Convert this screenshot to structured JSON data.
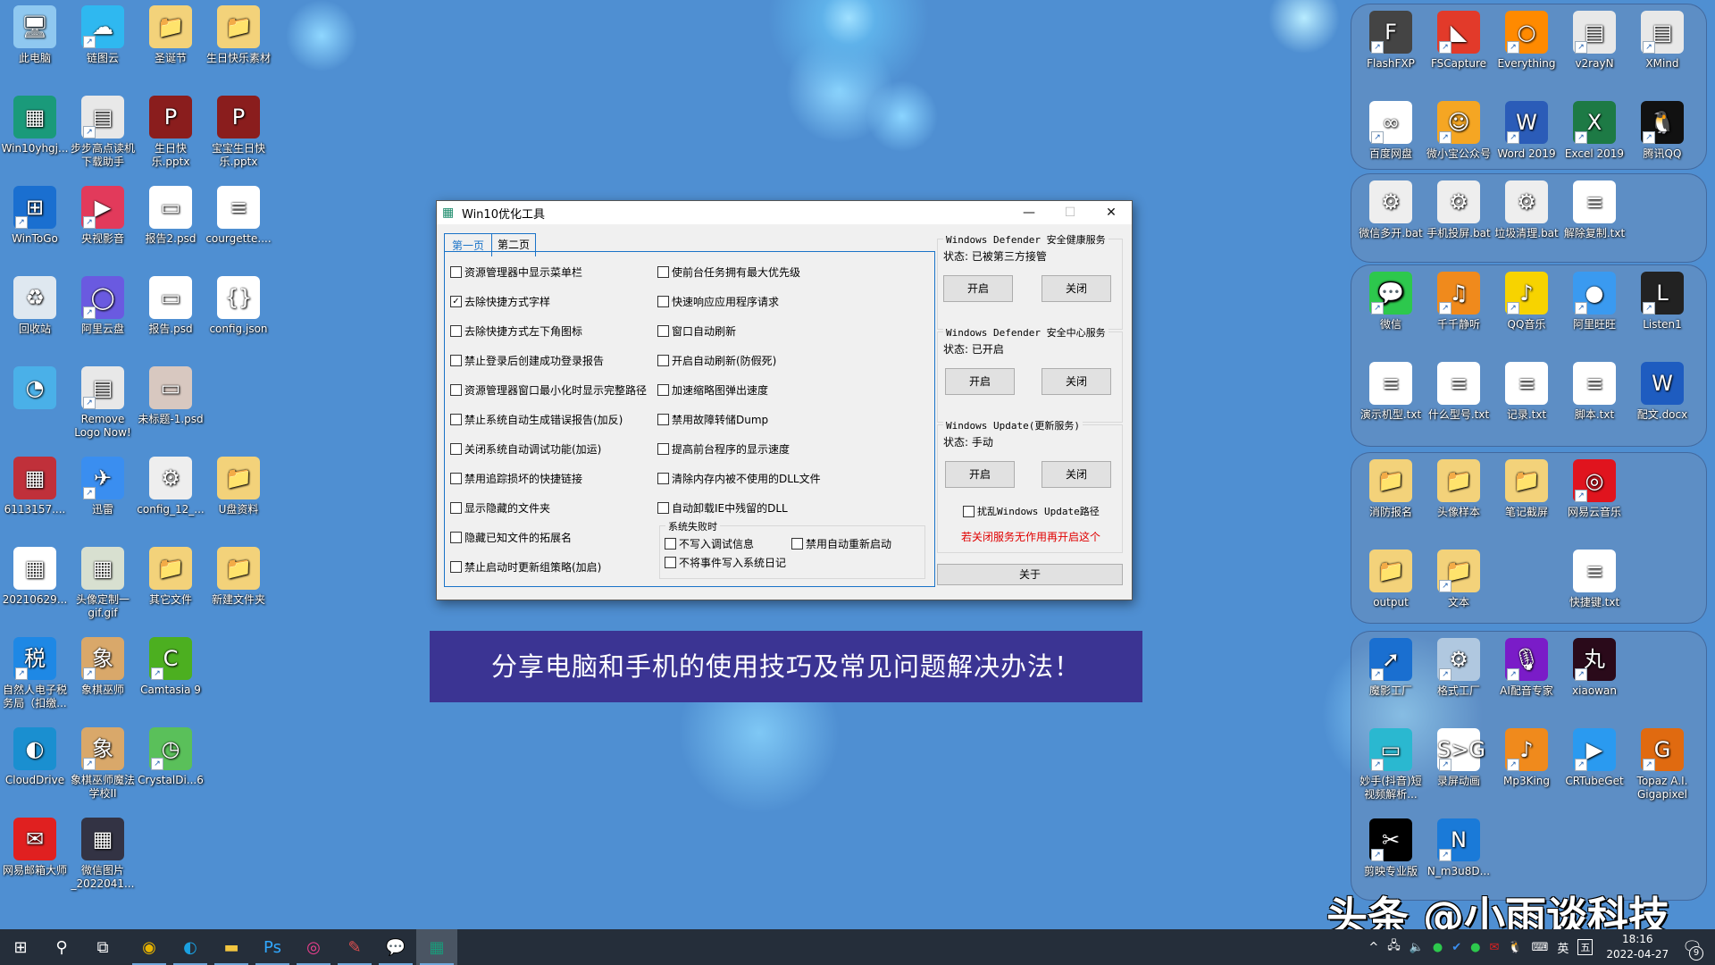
{
  "desktop_left": [
    {
      "label": "此电脑",
      "icon": "computer-icon",
      "glyph": "🖥",
      "color": "#8fc8f0",
      "shortcut": false
    },
    {
      "label": "链图云",
      "icon": "cloud-link-icon",
      "glyph": "☁",
      "color": "#2fb8f0",
      "shortcut": true
    },
    {
      "label": "圣诞节",
      "icon": "folder-icon",
      "glyph": "📁",
      "color": "#f3d27a",
      "shortcut": false
    },
    {
      "label": "生日快乐素材",
      "icon": "folder-icon",
      "glyph": "📁",
      "color": "#f3d27a",
      "shortcut": false
    },
    {
      "label": "Win10yhgj...",
      "icon": "win10-tool-icon",
      "glyph": "▦",
      "color": "#1a9a7a",
      "shortcut": false
    },
    {
      "label": "步步高点读机下载助手",
      "icon": "app-window-icon",
      "glyph": "▤",
      "color": "#e8e8e8",
      "shortcut": true
    },
    {
      "label": "生日快乐.pptx",
      "icon": "pptx-icon",
      "glyph": "P",
      "color": "#8a1d1d",
      "shortcut": false
    },
    {
      "label": "宝宝生日快乐.pptx",
      "icon": "pptx-icon",
      "glyph": "P",
      "color": "#8a1d1d",
      "shortcut": false
    },
    {
      "label": "WinToGo",
      "icon": "wintogo-icon",
      "glyph": "⊞",
      "color": "#1a6fd0",
      "shortcut": true
    },
    {
      "label": "央视影音",
      "icon": "cctv-player-icon",
      "glyph": "▶",
      "color": "#e23a5b",
      "shortcut": true
    },
    {
      "label": "报告2.psd",
      "icon": "psd-file-icon",
      "glyph": "▭",
      "color": "#ffffff",
      "shortcut": false
    },
    {
      "label": "courgette....",
      "icon": "text-file-icon",
      "glyph": "≡",
      "color": "#ffffff",
      "shortcut": false
    },
    {
      "label": "回收站",
      "icon": "recycle-bin-icon",
      "glyph": "♻",
      "color": "#dfe8f0",
      "shortcut": false
    },
    {
      "label": "阿里云盘",
      "icon": "aliyun-drive-icon",
      "glyph": "◯",
      "color": "#6a5ae0",
      "shortcut": true
    },
    {
      "label": "报告.psd",
      "icon": "psd-file-icon",
      "glyph": "▭",
      "color": "#ffffff",
      "shortcut": false
    },
    {
      "label": "config.json",
      "icon": "json-file-icon",
      "glyph": "{}",
      "color": "#ffffff",
      "shortcut": false
    },
    {
      "label": "",
      "icon": "control-panel-icon",
      "glyph": "◔",
      "color": "#4ab0e8",
      "shortcut": false
    },
    {
      "label": "Remove Logo Now!",
      "icon": "app-window-icon",
      "glyph": "▤",
      "color": "#e8e8e8",
      "shortcut": true
    },
    {
      "label": "未标题-1.psd",
      "icon": "psd-file-icon",
      "glyph": "▭",
      "color": "#d8c8c0",
      "shortcut": false
    },
    {
      "label": "",
      "icon": "",
      "glyph": "",
      "color": "",
      "shortcut": false
    },
    {
      "label": "6113157....",
      "icon": "image-file-icon",
      "glyph": "▦",
      "color": "#c0303a",
      "shortcut": false
    },
    {
      "label": "迅雷",
      "icon": "xunlei-icon",
      "glyph": "✈",
      "color": "#3a8ef0",
      "shortcut": true
    },
    {
      "label": "config_12_...",
      "icon": "config-file-icon",
      "glyph": "⚙",
      "color": "#eeeeee",
      "shortcut": false
    },
    {
      "label": "U盘资料",
      "icon": "folder-icon",
      "glyph": "📁",
      "color": "#f3d27a",
      "shortcut": false
    },
    {
      "label": "20210629...",
      "icon": "image-file-icon",
      "glyph": "▦",
      "color": "#ffffff",
      "shortcut": false
    },
    {
      "label": "头像定制一gif.gif",
      "icon": "gif-file-icon",
      "glyph": "▦",
      "color": "#d8e0d0",
      "shortcut": false
    },
    {
      "label": "其它文件",
      "icon": "folder-icon",
      "glyph": "📁",
      "color": "#f3d27a",
      "shortcut": false
    },
    {
      "label": "新建文件夹",
      "icon": "folder-icon",
      "glyph": "📁",
      "color": "#f3d27a",
      "shortcut": false
    },
    {
      "label": "自然人电子税务局（扣缴...",
      "icon": "tax-app-icon",
      "glyph": "税",
      "color": "#1e88e5",
      "shortcut": true
    },
    {
      "label": "象棋巫师",
      "icon": "chess-icon",
      "glyph": "象",
      "color": "#d9a86a",
      "shortcut": true
    },
    {
      "label": "Camtasia 9",
      "icon": "camtasia-icon",
      "glyph": "C",
      "color": "#4caf20",
      "shortcut": true
    },
    {
      "label": "",
      "icon": "",
      "glyph": "",
      "color": "",
      "shortcut": false
    },
    {
      "label": "CloudDrive",
      "icon": "edge-like-icon",
      "glyph": "◐",
      "color": "#1a8fd0",
      "shortcut": false
    },
    {
      "label": "象棋巫师魔法学校II",
      "icon": "chess-icon",
      "glyph": "象",
      "color": "#d9a86a",
      "shortcut": true
    },
    {
      "label": "CrystalDi...6",
      "icon": "crystaldisk-icon",
      "glyph": "◷",
      "color": "#5ac05a",
      "shortcut": true
    },
    {
      "label": "",
      "icon": "",
      "glyph": "",
      "color": "",
      "shortcut": false
    },
    {
      "label": "网易邮箱大师",
      "icon": "netease-mail-icon",
      "glyph": "✉",
      "color": "#e02020",
      "shortcut": false
    },
    {
      "label": "微信图片_2022041...",
      "icon": "image-file-icon",
      "glyph": "▦",
      "color": "#334",
      "shortcut": false
    }
  ],
  "groups": [
    {
      "items": [
        {
          "label": "FlashFXP",
          "icon": "flashfxp-icon",
          "glyph": "F",
          "color": "#444",
          "shortcut": true
        },
        {
          "label": "FSCapture",
          "icon": "fscapture-icon",
          "glyph": "◣",
          "color": "#e23a2a",
          "shortcut": true
        },
        {
          "label": "Everything",
          "icon": "everything-icon",
          "glyph": "○",
          "color": "#ff8a00",
          "shortcut": true
        },
        {
          "label": "v2rayN",
          "icon": "app-window-icon",
          "glyph": "▤",
          "color": "#e8e8e8",
          "shortcut": true
        },
        {
          "label": "XMind",
          "icon": "app-window-icon",
          "glyph": "▤",
          "color": "#e8e8e8",
          "shortcut": true
        },
        {
          "label": "百度网盘",
          "icon": "baidu-netdisk-icon",
          "glyph": "∞",
          "color": "#ffffff",
          "shortcut": true
        },
        {
          "label": "微小宝公众号",
          "icon": "weixiaobao-icon",
          "glyph": "☺",
          "color": "#f5a623",
          "shortcut": true
        },
        {
          "label": "Word 2019",
          "icon": "word-icon",
          "glyph": "W",
          "color": "#2b5cb8",
          "shortcut": true
        },
        {
          "label": "Excel 2019",
          "icon": "excel-icon",
          "glyph": "X",
          "color": "#1d7a45",
          "shortcut": true
        },
        {
          "label": "腾讯QQ",
          "icon": "qq-icon",
          "glyph": "🐧",
          "color": "#111",
          "shortcut": true
        }
      ]
    },
    {
      "items": [
        {
          "label": "微信多开.bat",
          "icon": "bat-file-icon",
          "glyph": "⚙",
          "color": "#eeeeee",
          "shortcut": false
        },
        {
          "label": "手机投屏.bat",
          "icon": "bat-file-icon",
          "glyph": "⚙",
          "color": "#eeeeee",
          "shortcut": false
        },
        {
          "label": "垃圾清理.bat",
          "icon": "bat-file-icon",
          "glyph": "⚙",
          "color": "#eeeeee",
          "shortcut": false
        },
        {
          "label": "解除复制.txt",
          "icon": "text-file-icon",
          "glyph": "≡",
          "color": "#ffffff",
          "shortcut": false
        }
      ]
    },
    {
      "items": [
        {
          "label": "微信",
          "icon": "wechat-icon",
          "glyph": "💬",
          "color": "#2dc84d",
          "shortcut": true
        },
        {
          "label": "千千静听",
          "icon": "ttplayer-icon",
          "glyph": "♫",
          "color": "#f08a1c",
          "shortcut": true
        },
        {
          "label": "QQ音乐",
          "icon": "qq-music-icon",
          "glyph": "♪",
          "color": "#f7d300",
          "shortcut": true
        },
        {
          "label": "阿里旺旺",
          "icon": "aliwangwang-icon",
          "glyph": "●",
          "color": "#3a9af0",
          "shortcut": true
        },
        {
          "label": "Listen1",
          "icon": "listen1-icon",
          "glyph": "L",
          "color": "#222",
          "shortcut": true
        },
        {
          "label": "演示机型.txt",
          "icon": "text-file-icon",
          "glyph": "≡",
          "color": "#ffffff",
          "shortcut": false
        },
        {
          "label": "什么型号.txt",
          "icon": "text-file-icon",
          "glyph": "≡",
          "color": "#ffffff",
          "shortcut": false
        },
        {
          "label": "记录.txt",
          "icon": "text-file-icon",
          "glyph": "≡",
          "color": "#ffffff",
          "shortcut": false
        },
        {
          "label": "脚本.txt",
          "icon": "text-file-icon",
          "glyph": "≡",
          "color": "#ffffff",
          "shortcut": false
        },
        {
          "label": "配文.docx",
          "icon": "docx-file-icon",
          "glyph": "W",
          "color": "#1e5cc0",
          "shortcut": false
        }
      ]
    },
    {
      "items": [
        {
          "label": "消防报名",
          "icon": "folder-icon",
          "glyph": "📁",
          "color": "#f3d27a",
          "shortcut": false
        },
        {
          "label": "头像样本",
          "icon": "folder-icon",
          "glyph": "📁",
          "color": "#f3d27a",
          "shortcut": false
        },
        {
          "label": "笔记截屏",
          "icon": "folder-icon",
          "glyph": "📁",
          "color": "#f3d27a",
          "shortcut": false
        },
        {
          "label": "网易云音乐",
          "icon": "netease-music-icon",
          "glyph": "◎",
          "color": "#e0141e",
          "shortcut": true
        },
        {
          "label": "",
          "icon": "",
          "glyph": "",
          "color": "",
          "shortcut": false
        },
        {
          "label": "output",
          "icon": "folder-icon",
          "glyph": "📁",
          "color": "#f3d27a",
          "shortcut": false
        },
        {
          "label": "文本",
          "icon": "folder-icon",
          "glyph": "📁",
          "color": "#f3d27a",
          "shortcut": true
        },
        {
          "label": "",
          "icon": "",
          "glyph": "",
          "color": "",
          "shortcut": false
        },
        {
          "label": "快捷键.txt",
          "icon": "text-file-icon",
          "glyph": "≡",
          "color": "#ffffff",
          "shortcut": false
        }
      ]
    },
    {
      "items": [
        {
          "label": "魔影工厂",
          "icon": "moying-icon",
          "glyph": "➚",
          "color": "#1a6fd0",
          "shortcut": true
        },
        {
          "label": "格式工厂",
          "icon": "format-factory-icon",
          "glyph": "⚙",
          "color": "#b0c8e0",
          "shortcut": true
        },
        {
          "label": "AI配音专家",
          "icon": "ai-voice-icon",
          "glyph": "🎙",
          "color": "#7a1cc8",
          "shortcut": true
        },
        {
          "label": "xiaowan",
          "icon": "xiaowan-icon",
          "glyph": "丸",
          "color": "#2a0a1a",
          "shortcut": true
        },
        {
          "label": "",
          "icon": "",
          "glyph": "",
          "color": "",
          "shortcut": false
        },
        {
          "label": "妙手(抖音)短视频解析...",
          "icon": "miaoshou-icon",
          "glyph": "▭",
          "color": "#2ab8d0",
          "shortcut": true
        },
        {
          "label": "录屏动画",
          "icon": "s2g-icon",
          "glyph": "S>G",
          "color": "#ffffff",
          "shortcut": true
        },
        {
          "label": "Mp3King",
          "icon": "mp3king-icon",
          "glyph": "♪",
          "color": "#f08a1c",
          "shortcut": true
        },
        {
          "label": "CRTubeGet",
          "icon": "crtubeget-icon",
          "glyph": "▶",
          "color": "#2a9af0",
          "shortcut": true
        },
        {
          "label": "Topaz A.I. Gigapixel",
          "icon": "topaz-icon",
          "glyph": "G",
          "color": "#e06a10",
          "shortcut": true
        },
        {
          "label": "剪映专业版",
          "icon": "capcut-icon",
          "glyph": "✂",
          "color": "#000000",
          "shortcut": true
        },
        {
          "label": "N_m3u8D...",
          "icon": "nm3u8-icon",
          "glyph": "N",
          "color": "#1a7ad8",
          "shortcut": true
        }
      ]
    }
  ],
  "dialog": {
    "title": "Win10优化工具",
    "minimize": "—",
    "maximize": "☐",
    "close": "✕",
    "tabs": [
      {
        "label": "第一页",
        "active": true
      },
      {
        "label": "第二页",
        "active": false
      }
    ],
    "left_options": [
      {
        "label": "资源管理器中显示菜单栏",
        "checked": false
      },
      {
        "label": "去除快捷方式字样",
        "checked": true
      },
      {
        "label": "去除快捷方式左下角图标",
        "checked": false
      },
      {
        "label": "禁止登录后创建成功登录报告",
        "checked": false
      },
      {
        "label": "资源管理器窗口最小化时显示完整路径",
        "checked": false
      },
      {
        "label": "禁止系统自动生成错误报告(加反)",
        "checked": false
      },
      {
        "label": "关闭系统自动调试功能(加运)",
        "checked": false
      },
      {
        "label": "禁用追踪损坏的快捷链接",
        "checked": false
      },
      {
        "label": "显示隐藏的文件夹",
        "checked": false
      },
      {
        "label": "隐藏已知文件的拓展名",
        "checked": false
      },
      {
        "label": "禁止启动时更新组策略(加启)",
        "checked": false
      }
    ],
    "right_options": [
      {
        "label": "使前台任务拥有最大优先级",
        "checked": false
      },
      {
        "label": "快速响应应用程序请求",
        "checked": false
      },
      {
        "label": "窗口自动刷新",
        "checked": false
      },
      {
        "label": "开启自动刷新(防假死)",
        "checked": false
      },
      {
        "label": "加速缩略图弹出速度",
        "checked": false
      },
      {
        "label": "禁用故障转储Dump",
        "checked": false
      },
      {
        "label": "提高前台程序的显示速度",
        "checked": false
      },
      {
        "label": "清除内存内被不使用的DLL文件",
        "checked": false
      },
      {
        "label": "自动卸载IE中残留的DLL",
        "checked": false
      }
    ],
    "failure_group": {
      "legend": "系统失败时",
      "options": [
        {
          "label": "不写入调试信息",
          "checked": false
        },
        {
          "label": "禁用自动重新启动",
          "checked": false
        },
        {
          "label": "不将事件写入系统日记",
          "checked": false
        }
      ]
    },
    "services": [
      {
        "legend": "Windows Defender 安全健康服务",
        "status": "状态: 已被第三方接管",
        "on": "开启",
        "off": "关闭"
      },
      {
        "legend": "Windows Defender 安全中心服务",
        "status": "状态: 已开启",
        "on": "开启",
        "off": "关闭"
      },
      {
        "legend": "Windows Update(更新服务)",
        "status": "状态: 手动",
        "on": "开启",
        "off": "关闭"
      }
    ],
    "scramble_option": {
      "label": "扰乱Windows Update路径",
      "checked": false
    },
    "warning": "若关闭服务无作用再开启这个",
    "about": "关于",
    "warning_color": "#e00000",
    "accent_color": "#1a73c8"
  },
  "banner": {
    "text": "分享电脑和手机的使用技巧及常见问题解决办法！",
    "bg": "#3b3493"
  },
  "watermark": "头条 @小雨谈科技",
  "taskbar": {
    "items": [
      {
        "name": "start-button",
        "glyph": "⊞"
      },
      {
        "name": "search-button",
        "glyph": "⚲"
      },
      {
        "name": "task-view-button",
        "glyph": "⧉"
      },
      {
        "name": "chrome-taskbar-icon",
        "glyph": "◉",
        "color": "#e8b400"
      },
      {
        "name": "edge-taskbar-icon",
        "glyph": "◐",
        "color": "#1aa0e0"
      },
      {
        "name": "file-explorer-taskbar-icon",
        "glyph": "▬",
        "color": "#f3c640"
      },
      {
        "name": "photoshop-taskbar-icon",
        "glyph": "Ps",
        "color": "#31a8ff"
      },
      {
        "name": "color-app-taskbar-icon",
        "glyph": "◎",
        "color": "#f04090"
      },
      {
        "name": "notepad-plus-taskbar-icon",
        "glyph": "✎",
        "color": "#e05050"
      },
      {
        "name": "wechat-taskbar-icon",
        "glyph": "💬",
        "color": "#2dc84d"
      },
      {
        "name": "win10-tool-taskbar-icon",
        "glyph": "▦",
        "color": "#1a9a7a"
      }
    ],
    "tray": {
      "expand": "^",
      "network": "🖧",
      "volume": "🔈",
      "ime_lang": "英",
      "ime_mode": "五",
      "time": "18:16",
      "date": "2022-04-27",
      "notifications": "9"
    }
  }
}
